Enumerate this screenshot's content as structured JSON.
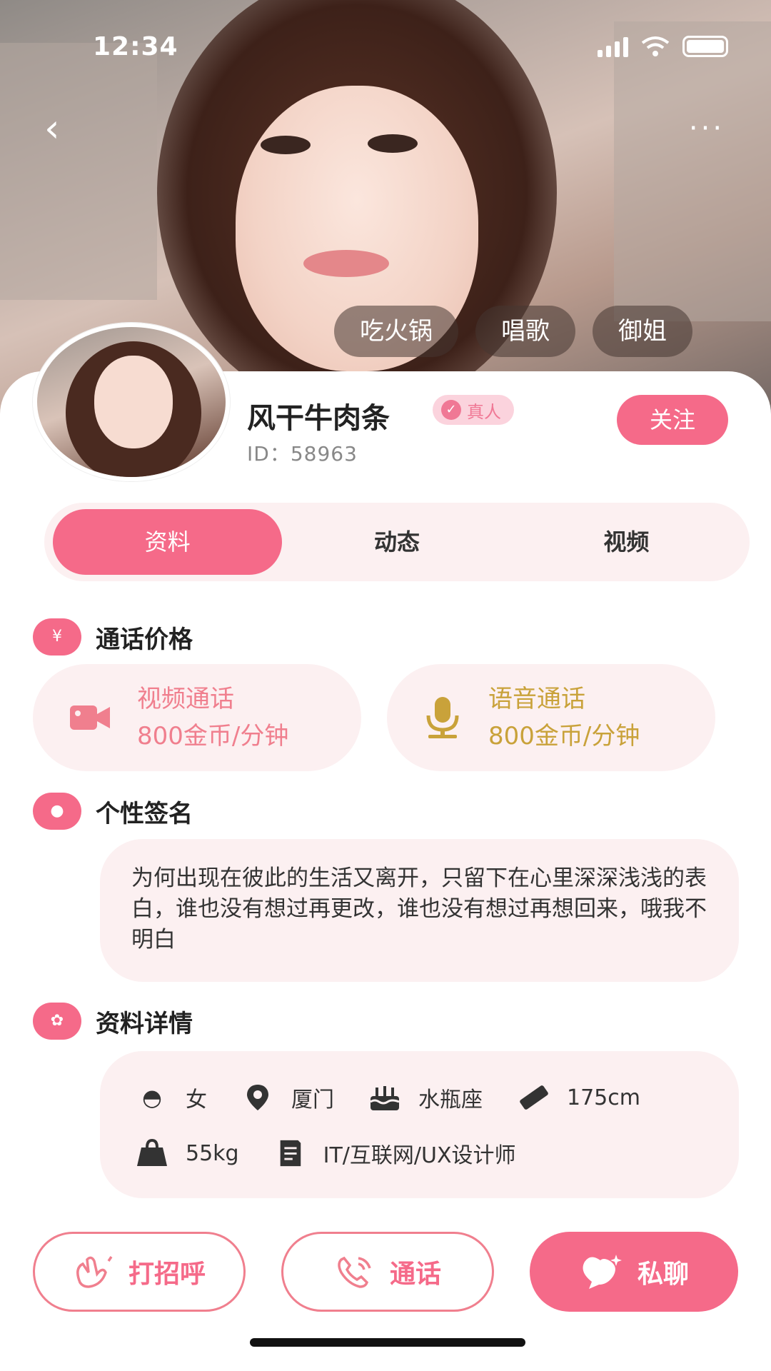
{
  "status": {
    "time": "12:34"
  },
  "tags": [
    "吃火锅",
    "唱歌",
    "御姐"
  ],
  "profile": {
    "name": "风干牛肉条",
    "verified_label": "真人",
    "id_text": "ID：58963",
    "follow_label": "关注"
  },
  "tabs": [
    {
      "label": "资料",
      "active": true
    },
    {
      "label": "动态",
      "active": false
    },
    {
      "label": "视频",
      "active": false
    }
  ],
  "call_price": {
    "title": "通话价格",
    "video": {
      "label": "视频通话",
      "price": "800金币/分钟"
    },
    "voice": {
      "label": "语音通话",
      "price": "800金币/分钟"
    }
  },
  "signature": {
    "title": "个性签名",
    "text": "为何出现在彼此的生活又离开，只留下在心里深深浅浅的表白，谁也没有想过再更改，谁也没有想过再想回来，哦我不明白"
  },
  "details": {
    "title": "资料详情",
    "gender": "女",
    "city": "厦门",
    "zodiac": "水瓶座",
    "height": "175cm",
    "weight": "55kg",
    "job": "IT/互联网/UX设计师"
  },
  "actions": {
    "greet": "打招呼",
    "call": "通话",
    "chat": "私聊"
  },
  "colors": {
    "accent": "#f56a89",
    "card_bg": "#fcf0f1",
    "voice_gold": "#c9a23a"
  }
}
